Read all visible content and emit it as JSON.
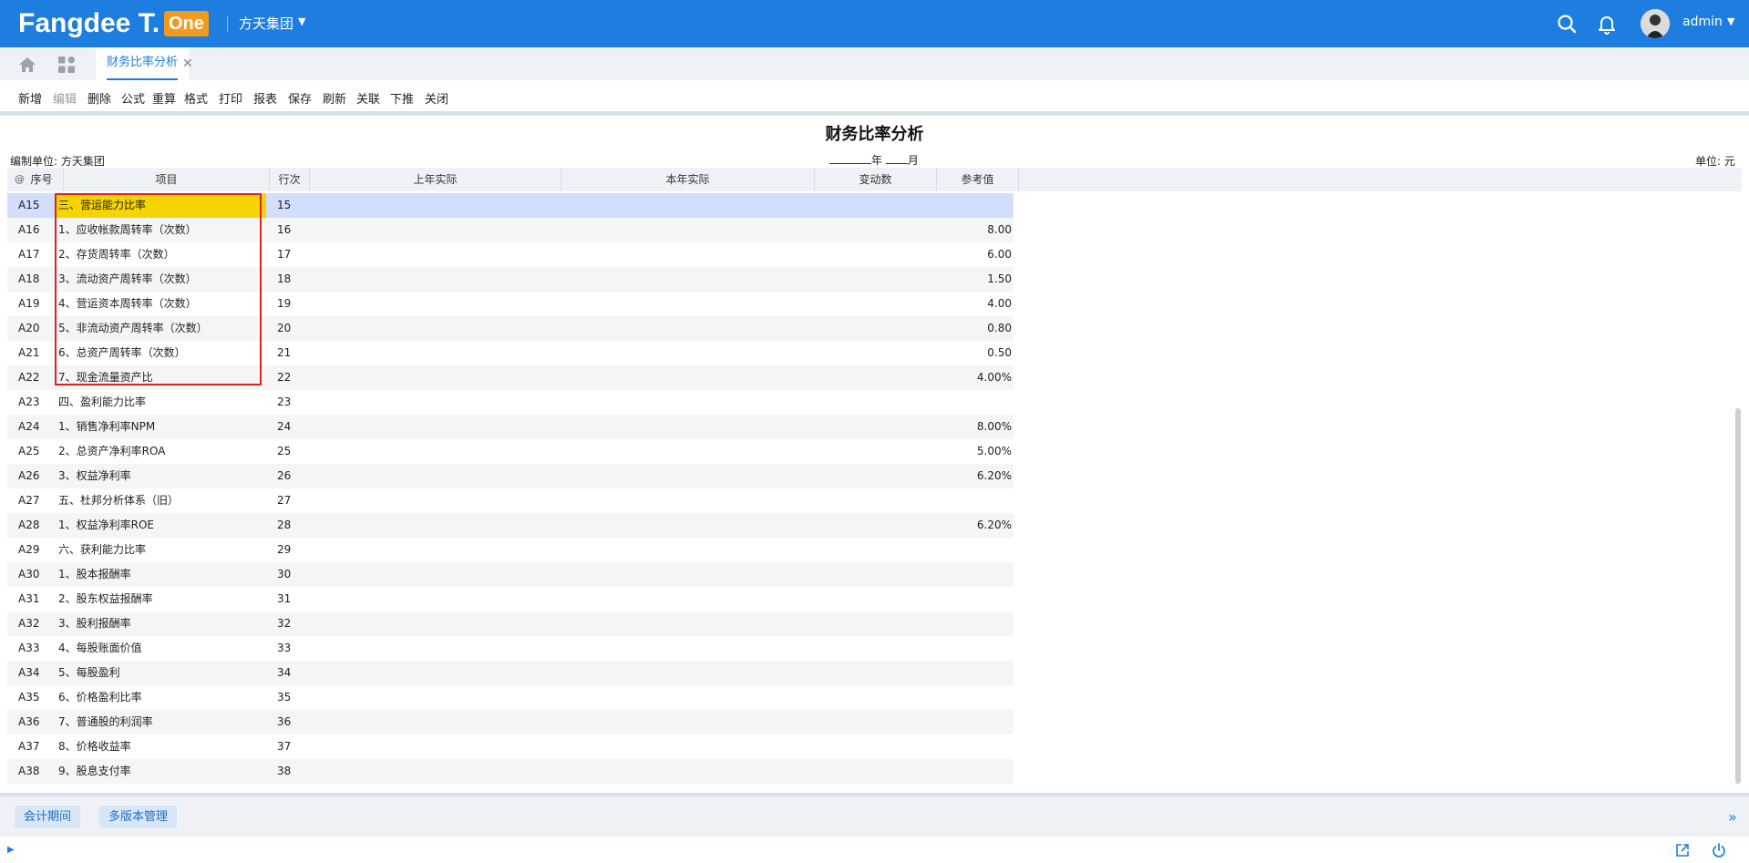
{
  "header": {
    "logo_text": "Fangdee T.",
    "logo_badge": "One",
    "org_name": "方天集团",
    "user_name": "admin"
  },
  "tabs": {
    "active_label": "财务比率分析"
  },
  "toolbar": {
    "items": [
      "新增",
      "编辑",
      "删除",
      "公式",
      "重算",
      "格式",
      "打印",
      "报表",
      "保存",
      "刷新",
      "关联",
      "下推",
      "关闭"
    ]
  },
  "report": {
    "title": "财务比率分析",
    "unit_left": "编制单位: 方天集团",
    "year_suffix": "年",
    "month_suffix": "月",
    "unit_right": "单位: 元"
  },
  "table": {
    "corner": "@",
    "columns": [
      "序号",
      "项目",
      "行次",
      "上年实际",
      "本年实际",
      "变动数",
      "参考值"
    ],
    "rows": [
      {
        "code": "A15",
        "item": "三、营运能力比率",
        "line": "15",
        "ref": ""
      },
      {
        "code": "A16",
        "item": "1、应收帐款周转率（次数）",
        "line": "16",
        "ref": "8.00"
      },
      {
        "code": "A17",
        "item": "2、存货周转率（次数）",
        "line": "17",
        "ref": "6.00"
      },
      {
        "code": "A18",
        "item": "3、流动资产周转率（次数）",
        "line": "18",
        "ref": "1.50"
      },
      {
        "code": "A19",
        "item": "4、营运资本周转率（次数）",
        "line": "19",
        "ref": "4.00"
      },
      {
        "code": "A20",
        "item": "5、非流动资产周转率（次数）",
        "line": "20",
        "ref": "0.80"
      },
      {
        "code": "A21",
        "item": "6、总资产周转率（次数）",
        "line": "21",
        "ref": "0.50"
      },
      {
        "code": "A22",
        "item": "7、现金流量资产比",
        "line": "22",
        "ref": "4.00%"
      },
      {
        "code": "A23",
        "item": "四、盈利能力比率",
        "line": "23",
        "ref": ""
      },
      {
        "code": "A24",
        "item": "1、销售净利率NPM",
        "line": "24",
        "ref": "8.00%"
      },
      {
        "code": "A25",
        "item": "2、总资产净利率ROA",
        "line": "25",
        "ref": "5.00%"
      },
      {
        "code": "A26",
        "item": "3、权益净利率",
        "line": "26",
        "ref": "6.20%"
      },
      {
        "code": "A27",
        "item": "五、杜邦分析体系（旧）",
        "line": "27",
        "ref": ""
      },
      {
        "code": "A28",
        "item": "1、权益净利率ROE",
        "line": "28",
        "ref": "6.20%"
      },
      {
        "code": "A29",
        "item": "六、获利能力比率",
        "line": "29",
        "ref": ""
      },
      {
        "code": "A30",
        "item": "1、股本报酬率",
        "line": "30",
        "ref": ""
      },
      {
        "code": "A31",
        "item": "2、股东权益报酬率",
        "line": "31",
        "ref": ""
      },
      {
        "code": "A32",
        "item": "3、股利报酬率",
        "line": "32",
        "ref": ""
      },
      {
        "code": "A33",
        "item": "4、每股账面价值",
        "line": "33",
        "ref": ""
      },
      {
        "code": "A34",
        "item": "5、每股盈利",
        "line": "34",
        "ref": ""
      },
      {
        "code": "A35",
        "item": "6、价格盈利比率",
        "line": "35",
        "ref": ""
      },
      {
        "code": "A36",
        "item": "7、普通股的利润率",
        "line": "36",
        "ref": ""
      },
      {
        "code": "A37",
        "item": "8、价格收益率",
        "line": "37",
        "ref": ""
      },
      {
        "code": "A38",
        "item": "9、股息支付率",
        "line": "38",
        "ref": ""
      }
    ]
  },
  "footer": {
    "buttons": [
      "会计期间",
      "多版本管理"
    ]
  },
  "colors": {
    "header_bg": "#1d7ee0",
    "badge": "#f29b1a",
    "selected_row": "#d2defb",
    "highlight_cell": "#f5d400",
    "annotation_box": "#e02020"
  }
}
